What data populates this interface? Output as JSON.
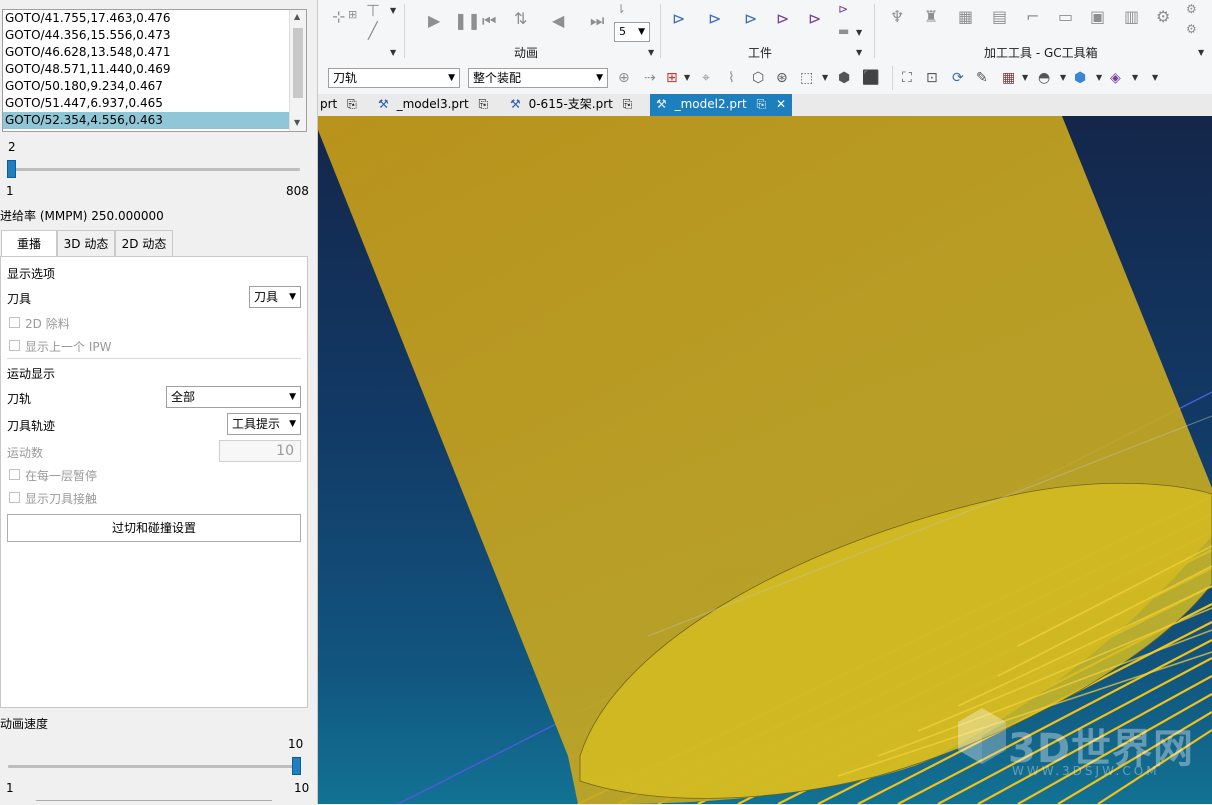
{
  "list": {
    "rows": [
      "GOTO/41.755,17.463,0.476",
      "GOTO/44.356,15.556,0.473",
      "GOTO/46.628,13.548,0.471",
      "GOTO/48.571,11.440,0.469",
      "GOTO/50.180,9.234,0.467",
      "GOTO/51.447,6.937,0.465",
      "GOTO/52.354,4.556,0.463"
    ],
    "selected_index": 6
  },
  "step_slider": {
    "value": "2",
    "min": "1",
    "max": "808",
    "position_fraction": 0.001
  },
  "feed_rate": "进给率 (MMPM) 250.000000",
  "tabs": [
    "重播",
    "3D 动态",
    "2D 动态"
  ],
  "display_options": {
    "heading": "显示选项",
    "tool_label": "刀具",
    "tool_value": "刀具",
    "remove_2d": "2D 除料",
    "show_prev_ipw": "显示上一个 IPW"
  },
  "motion_display": {
    "heading": "运动显示",
    "toolpath_label": "刀轨",
    "toolpath_value": "全部",
    "trace_label": "刀具轨迹",
    "trace_value": "工具提示",
    "motion_count_label": "运动数",
    "motion_count_value": "10",
    "pause_each_layer": "在每一层暂停",
    "show_tool_contact": "显示刀具接触"
  },
  "gouge_button": "过切和碰撞设置",
  "anim_speed": {
    "label": "动画速度",
    "value": "10",
    "min": "1",
    "max": "10",
    "position_fraction": 1.0
  },
  "ribbon": {
    "groups": [
      "动画",
      "工件",
      "加工工具 - GC工具箱"
    ],
    "speed_select": "5"
  },
  "toolbar2": {
    "select1": "刀轨",
    "select2": "整个装配"
  },
  "file_tabs": [
    {
      "name": "prt",
      "active": false
    },
    {
      "name": "_model3.prt",
      "active": false
    },
    {
      "name": "0-615-支架.prt",
      "active": false
    },
    {
      "name": "_model2.prt",
      "active": true
    }
  ],
  "watermark": {
    "text": "3D世界网",
    "url": "WWW.3DSJW.COM"
  },
  "colors": {
    "accent": "#1e7fbe",
    "tool_yellow": "#d4b416",
    "selection": "#8fc7d6"
  }
}
